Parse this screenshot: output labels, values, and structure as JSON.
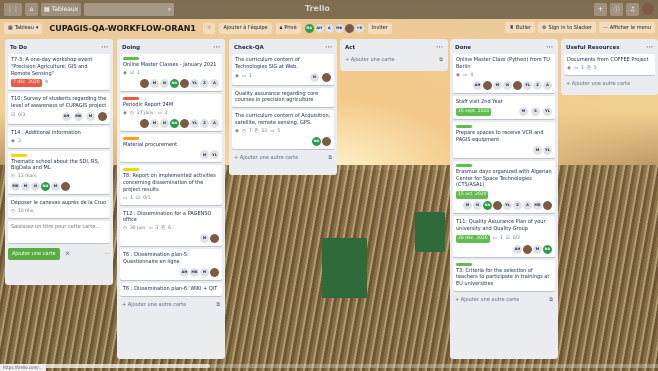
{
  "topbar": {
    "board_button": "Tableaux",
    "logo": "Trello"
  },
  "boardbar": {
    "view": "Tableau",
    "title": "CUPAGIS-QA-WORKFLOW-ORAN1",
    "team": "Ajouter à l'équipe",
    "privacy": "Privé",
    "extra_members": "+6",
    "invite": "Inviter",
    "butler": "Butler",
    "slack": "Sign in to Slacker",
    "menu": "Afficher le menu"
  },
  "lists": [
    {
      "title": "To Do",
      "cards": [
        {
          "text": "T7-3: A one-day workshop event \"Precision Agriculture: GIS and Remote Sensing\"",
          "date": "7 déc. 2020"
        },
        {
          "text": "T10: Survey of students regarding the level of awareness of CUPAGIS project",
          "badge": "0/3",
          "members": [
            "AH",
            "MK",
            "M"
          ]
        },
        {
          "text": "T14 : Additional information",
          "badge": "3"
        },
        {
          "text": "Thematic school about the SDI, RS, BigData and ML",
          "badge": "13 mars",
          "members": [
            "MK",
            "M",
            "N",
            "NA",
            "M"
          ]
        },
        {
          "text": "Déposer le canevas auprès de la Cruo",
          "badge": "10 févr."
        }
      ],
      "composer": "Saisissez un titre pour cette carte...",
      "add_card": "Ajouter une carte"
    },
    {
      "title": "Doing",
      "cards": [
        {
          "text": "Online Master Classes - January 2021",
          "badge": "1",
          "members": [
            "M",
            "N",
            "NA",
            "YL",
            "Z",
            "A"
          ]
        },
        {
          "text": "Periodic Report 24M",
          "badge": "27 janv.",
          "badge2": "2",
          "members": [
            "M",
            "N",
            "NA",
            "YL",
            "Z",
            "A"
          ]
        },
        {
          "text": "Material procurement",
          "members": [
            "M",
            "YL"
          ]
        },
        {
          "text": "T8: Report on implemented activities concerning dissemination of the project results",
          "badge": "1",
          "badge2": "0/1"
        },
        {
          "text": "T12 : Dissemination for a PAGENSO office",
          "badge": "30 juin",
          "badge2": "3",
          "badge3": "6"
        },
        {
          "text": "T6 : Dissemination plan-5: Questionnaire en ligne",
          "members": [
            "AH",
            "MK",
            "M"
          ]
        },
        {
          "text": "T6 : Dissemination plan-6: WIKI + QIT"
        }
      ],
      "add_card": "Ajouter une autre carte"
    },
    {
      "title": "Check-QA",
      "cards": [
        {
          "text": "The curriculum content of Technologies SIG at Web.",
          "badge": "1",
          "members": [
            "N"
          ]
        },
        {
          "text": "Quality assurance regarding core courses in precision agriculture"
        },
        {
          "text": "The curriculum content of Acquisition, satellite, remote sensing, GPS.",
          "badge": "7",
          "badge2": "23",
          "badge3": "5",
          "members": [
            "NA"
          ]
        }
      ],
      "add_card": "Ajouter une autre carte"
    },
    {
      "title": "Act",
      "cards": [],
      "add_card": "Ajouter une carte"
    },
    {
      "title": "Done",
      "cards": [
        {
          "text": "Online Master Class (Python) from TU Berlin",
          "badge": "4",
          "members": [
            "AH",
            "M",
            "N",
            "YL",
            "Z",
            "A"
          ]
        },
        {
          "text": "Staff visit 2nd Year",
          "date": "16 sept. 2020",
          "members": [
            "M",
            "S",
            "YL"
          ]
        },
        {
          "text": "Prepare spaces to receive VCR and PAGIS equipment",
          "members": [
            "M",
            "YL"
          ]
        },
        {
          "text": "Erasmus days organized with Algerian Center for Space Technologies (CTS/ASAL)",
          "date": "15 oct. 2020",
          "members": [
            "M",
            "N",
            "NA",
            "YL",
            "Z",
            "A",
            "MK"
          ]
        },
        {
          "text": "T11: Quality Assurance Plan of your university and Quality Group",
          "date": "28 déc. 2020",
          "badge": "1",
          "badge2": "0/2",
          "members": [
            "AH",
            "M",
            "NA"
          ]
        },
        {
          "text": "T3: Criteria for the selection of teachers to participate in trainings at EU universities"
        }
      ],
      "add_card": "Ajouter une autre carte"
    },
    {
      "title": "Useful Resources",
      "cards": [
        {
          "text": "Documents from COFFEE Project",
          "badge": "1",
          "badge2": "5"
        }
      ],
      "add_card": "Ajouter une autre carte"
    }
  ],
  "status_url": "https://trello.com/..."
}
